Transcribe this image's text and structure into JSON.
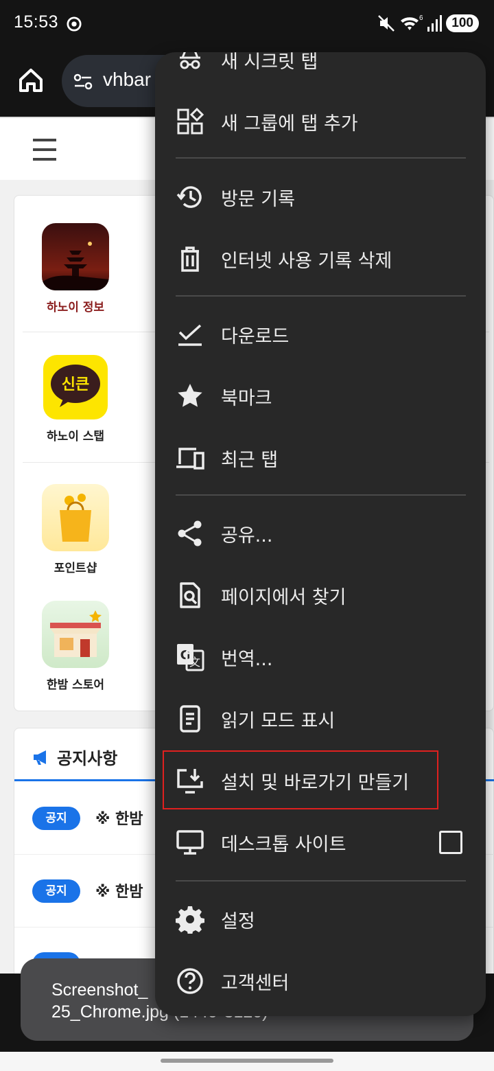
{
  "status_bar": {
    "time": "15:53",
    "wifi_badge": "6",
    "battery": "100"
  },
  "toolbar": {
    "url": "vhbar"
  },
  "page": {
    "apps": [
      {
        "label": "하노이 정보",
        "icon": "pagoda-night-icon"
      },
      {
        "label": "하노이 스탭",
        "icon": "kakao-chat-icon",
        "icon_text": "신큰"
      },
      {
        "label": "포인트샵",
        "icon": "shopping-bag-icon"
      },
      {
        "label": "한밤 스토어",
        "icon": "storefront-icon"
      }
    ],
    "notice": {
      "title": "공지사항",
      "rows": [
        {
          "badge": "공지",
          "text": "※ 한밤"
        },
        {
          "badge": "공지",
          "text": "※ 한밤"
        }
      ]
    }
  },
  "menu": {
    "items": [
      {
        "label": "새 시크릿 탭",
        "icon": "incognito-icon"
      },
      {
        "label": "새 그룹에 탭 추가",
        "icon": "tab-group-icon"
      },
      {
        "label": "방문 기록",
        "icon": "history-icon"
      },
      {
        "label": "인터넷 사용 기록 삭제",
        "icon": "trash-icon"
      },
      {
        "label": "다운로드",
        "icon": "download-check-icon"
      },
      {
        "label": "북마크",
        "icon": "star-icon"
      },
      {
        "label": "최근 탭",
        "icon": "devices-icon"
      },
      {
        "label": "공유...",
        "icon": "share-icon"
      },
      {
        "label": "페이지에서 찾기",
        "icon": "find-in-page-icon"
      },
      {
        "label": "번역...",
        "icon": "translate-icon"
      },
      {
        "label": "읽기 모드 표시",
        "icon": "reader-mode-icon"
      },
      {
        "label": "설치 및 바로가기 만들기",
        "icon": "install-app-icon"
      },
      {
        "label": "데스크톱 사이트",
        "icon": "desktop-icon",
        "checked": false
      },
      {
        "label": "설정",
        "icon": "gear-icon"
      },
      {
        "label": "고객센터",
        "icon": "help-icon"
      }
    ]
  },
  "toast": {
    "line1": "Screenshot_",
    "line2": "25_Chrome.jpg (1440*3120)"
  },
  "colors": {
    "menu_bg": "#282828",
    "highlight": "#e0201f",
    "accent_blue": "#1a73e8"
  }
}
